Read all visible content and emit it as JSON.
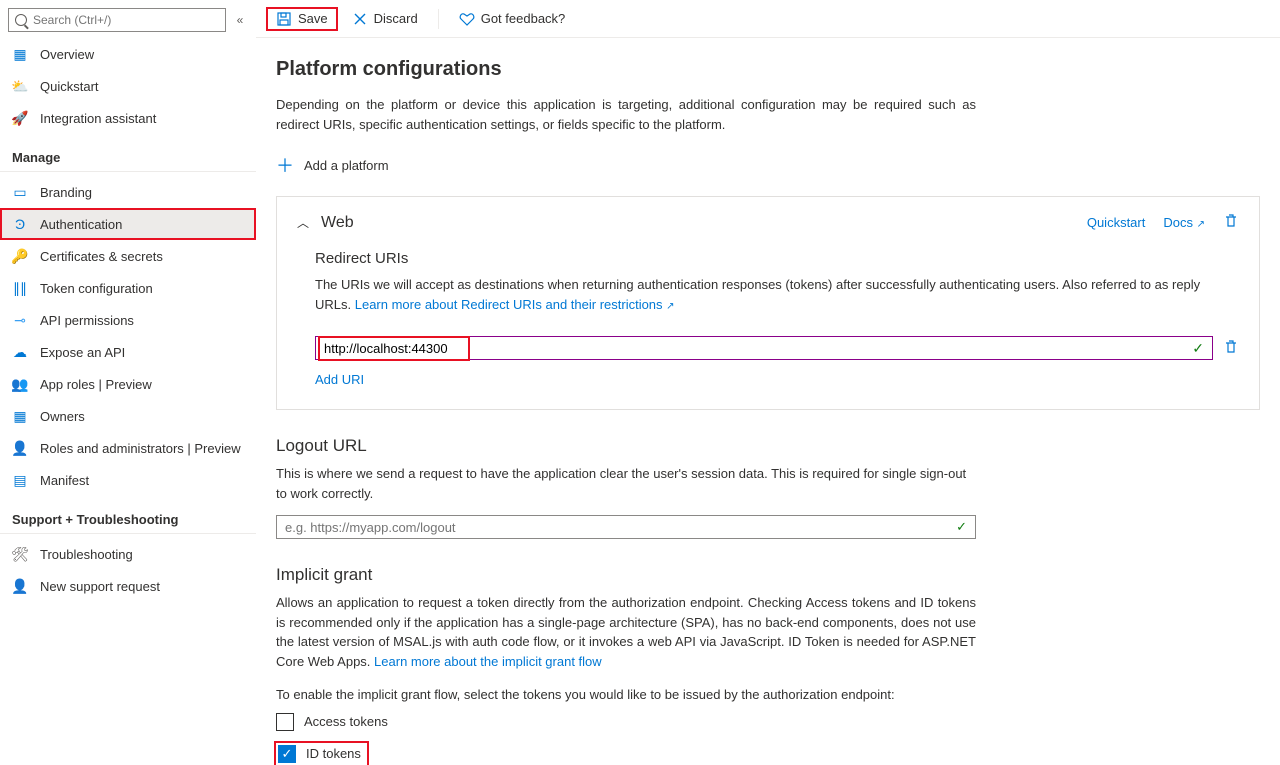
{
  "search": {
    "placeholder": "Search (Ctrl+/)"
  },
  "nav": {
    "overview": "Overview",
    "quickstart": "Quickstart",
    "integration_assistant": "Integration assistant",
    "manage_header": "Manage",
    "branding": "Branding",
    "authentication": "Authentication",
    "certs_secrets": "Certificates & secrets",
    "token_config": "Token configuration",
    "api_permissions": "API permissions",
    "expose_api": "Expose an API",
    "app_roles": "App roles | Preview",
    "owners": "Owners",
    "roles_admins": "Roles and administrators | Preview",
    "manifest": "Manifest",
    "support_header": "Support + Troubleshooting",
    "troubleshooting": "Troubleshooting",
    "new_support": "New support request"
  },
  "toolbar": {
    "save": "Save",
    "discard": "Discard",
    "feedback": "Got feedback?"
  },
  "page": {
    "title": "Platform configurations",
    "desc": "Depending on the platform or device this application is targeting, additional configuration may be required such as redirect URIs, specific authentication settings, or fields specific to the platform.",
    "add_platform": "Add a platform"
  },
  "web": {
    "title": "Web",
    "quickstart": "Quickstart",
    "docs": "Docs",
    "redirect_heading": "Redirect URIs",
    "redirect_desc": "The URIs we will accept as destinations when returning authentication responses (tokens) after successfully authenticating users. Also referred to as reply URLs. ",
    "redirect_link": "Learn more about Redirect URIs and their restrictions",
    "uri_value": "http://localhost:44300",
    "add_uri": "Add URI"
  },
  "logout": {
    "heading": "Logout URL",
    "desc": "This is where we send a request to have the application clear the user's session data. This is required for single sign-out to work correctly.",
    "placeholder": "e.g. https://myapp.com/logout"
  },
  "implicit": {
    "heading": "Implicit grant",
    "desc": "Allows an application to request a token directly from the authorization endpoint. Checking Access tokens and ID tokens is recommended only if the application has a single-page architecture (SPA), has no back-end components, does not use the latest version of MSAL.js with auth code flow, or it invokes a web API via JavaScript. ID Token is needed for ASP.NET Core Web Apps. ",
    "link": "Learn more about the implicit grant flow",
    "enable_text": "To enable the implicit grant flow, select the tokens you would like to be issued by the authorization endpoint:",
    "access_tokens": "Access tokens",
    "id_tokens": "ID tokens"
  }
}
